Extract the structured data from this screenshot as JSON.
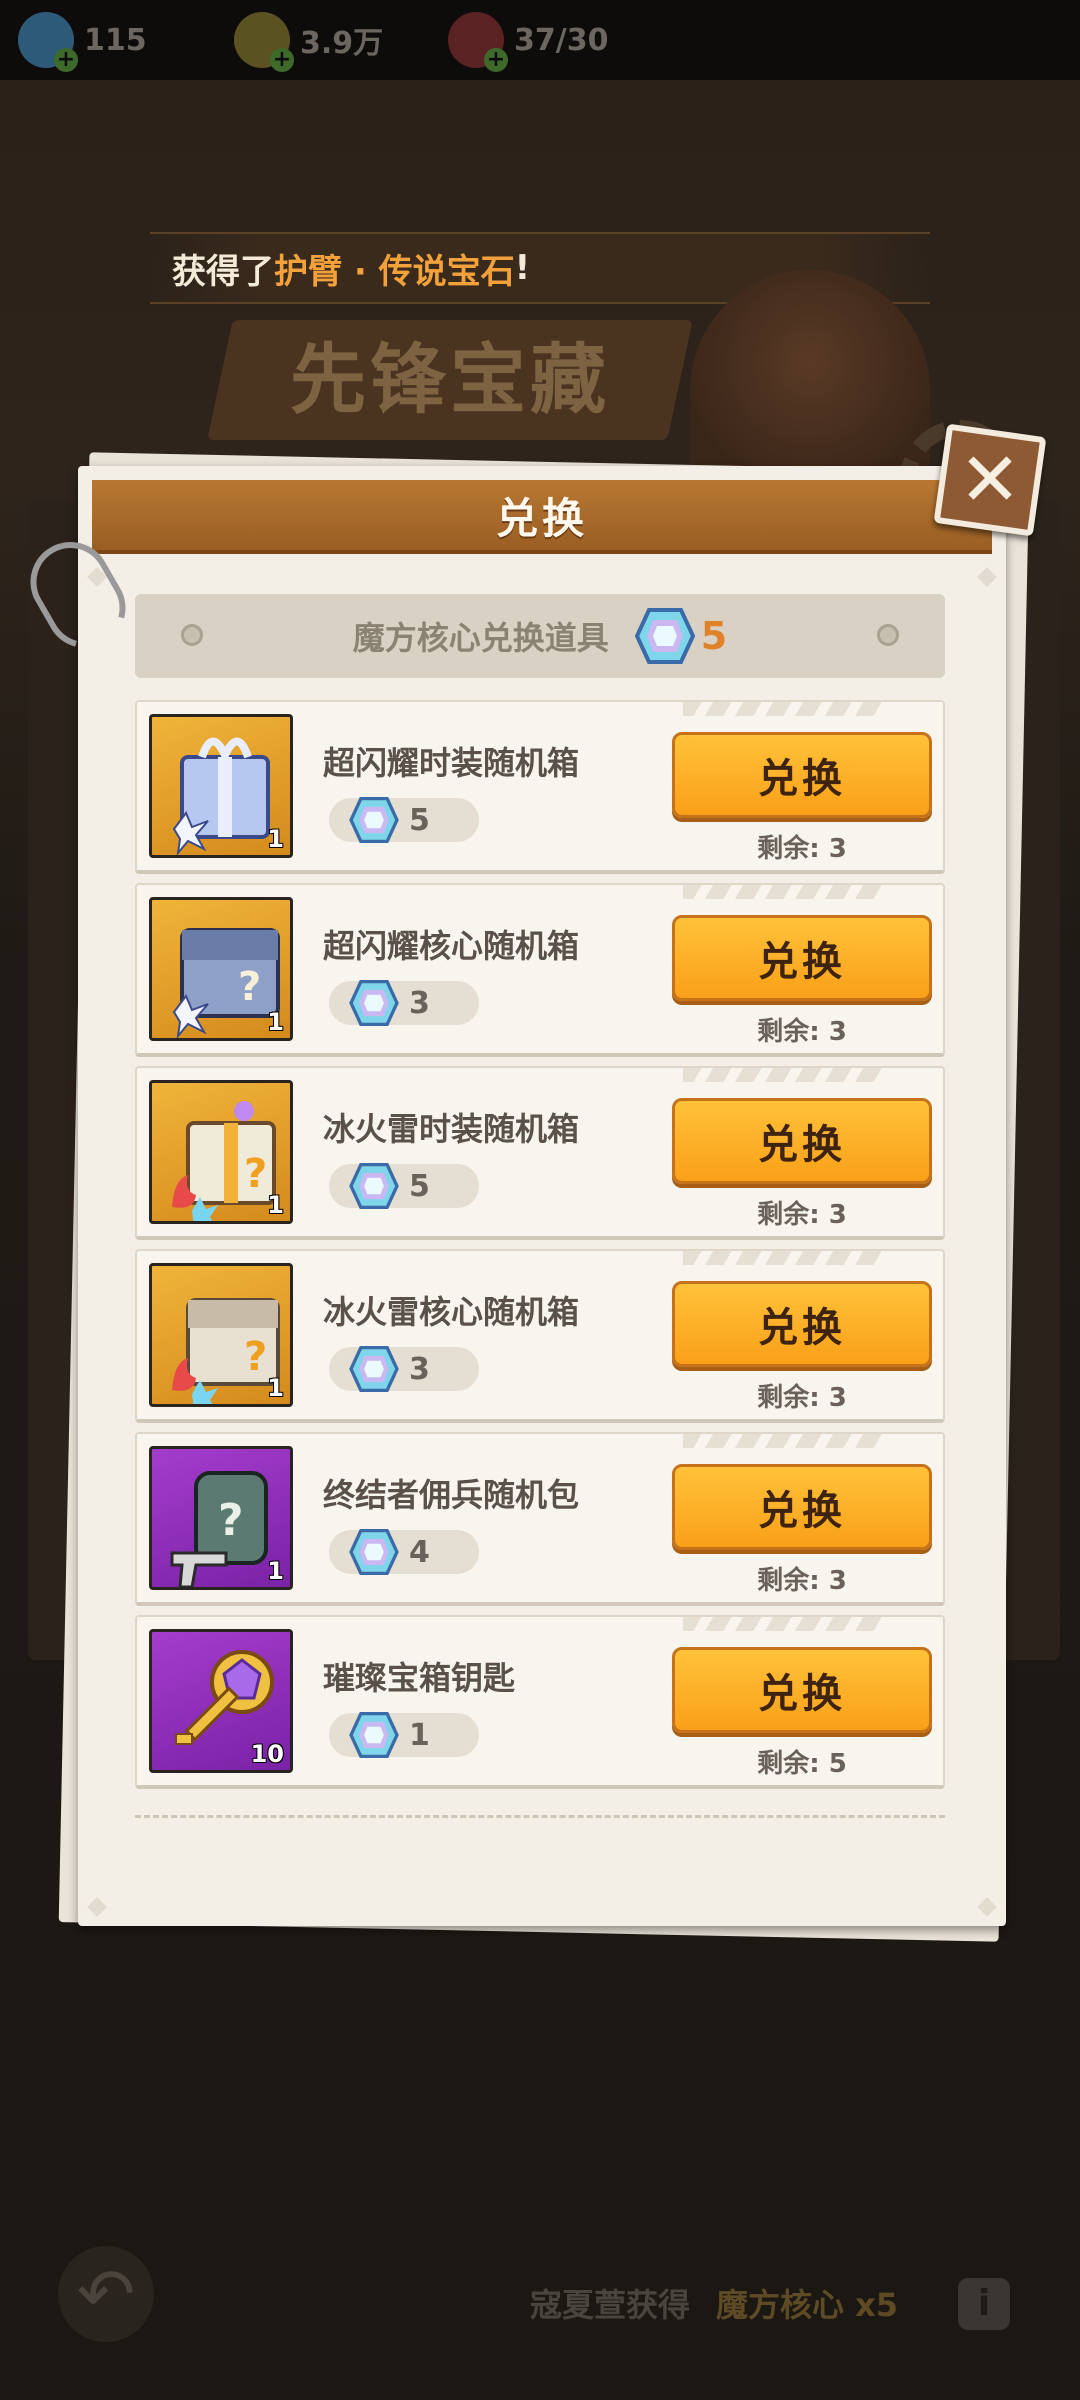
{
  "resources": [
    {
      "icon": "cube-icon",
      "value": "115",
      "color": "#3a8ab8"
    },
    {
      "icon": "coin-icon",
      "value": "3.9万",
      "color": "#8a7a2a"
    },
    {
      "icon": "meat-icon",
      "value": "37/30",
      "color": "#8a2a2a"
    }
  ],
  "banner": {
    "prefix": "获得了",
    "highlight": "护臂 · 传说宝石",
    "suffix": "!"
  },
  "event_title": "先锋宝藏",
  "dialog": {
    "title": "兑换",
    "close_symbol": "✕",
    "currency_label": "魔方核心兑换道具",
    "currency_amount": "5",
    "redeem_label": "兑换",
    "remaining_prefix": "剩余:",
    "items": [
      {
        "name": "超闪耀时装随机箱",
        "cost": "5",
        "qty": "1",
        "remaining": "3",
        "frame": "gold",
        "icon": "blue-gift-box-icon"
      },
      {
        "name": "超闪耀核心随机箱",
        "cost": "3",
        "qty": "1",
        "remaining": "3",
        "frame": "gold",
        "icon": "blue-mystery-chest-icon"
      },
      {
        "name": "冰火雷时装随机箱",
        "cost": "5",
        "qty": "1",
        "remaining": "3",
        "frame": "gold",
        "icon": "fire-ice-gift-box-icon"
      },
      {
        "name": "冰火雷核心随机箱",
        "cost": "3",
        "qty": "1",
        "remaining": "3",
        "frame": "gold",
        "icon": "fire-ice-mystery-chest-icon"
      },
      {
        "name": "终结者佣兵随机包",
        "cost": "4",
        "qty": "1",
        "remaining": "3",
        "frame": "purple",
        "icon": "mercenary-backpack-icon"
      },
      {
        "name": "璀璨宝箱钥匙",
        "cost": "1",
        "qty": "10",
        "remaining": "5",
        "frame": "purple",
        "icon": "gem-key-icon"
      }
    ]
  },
  "footer": {
    "back_symbol": "↶",
    "gain_text": "寇夏萱获得",
    "gain_item": "魔方核心 x5",
    "info_symbol": "i"
  }
}
